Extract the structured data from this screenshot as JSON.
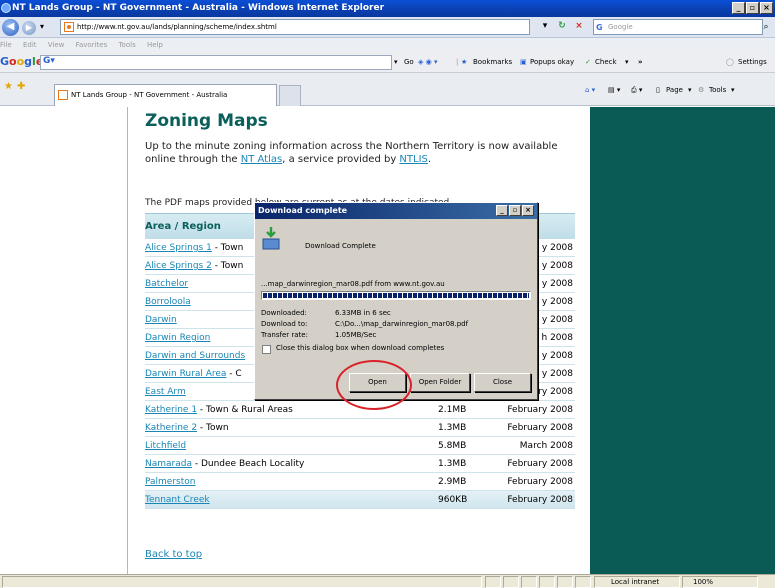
{
  "window": {
    "title": "NT Lands Group - NT Government - Australia - Windows Internet Explorer"
  },
  "address": {
    "url": "http://www.nt.gov.au/lands/planning/scheme/index.shtml"
  },
  "search": {
    "placeholder": "Google"
  },
  "menu": [
    "File",
    "Edit",
    "View",
    "Favorites",
    "Tools",
    "Help"
  ],
  "google_toolbar": {
    "logo": "Google",
    "go_label": "Go",
    "bookmarks": "Bookmarks",
    "popups": "Popups okay",
    "check": "Check",
    "more": "»",
    "settings": "Settings"
  },
  "tab": {
    "title": "NT Lands Group - NT Government - Australia"
  },
  "command_bar": {
    "page": "Page",
    "tools": "Tools"
  },
  "page": {
    "heading": "Zoning Maps",
    "intro_before": "Up to the minute zoning information across the Northern Territory is now available online through the ",
    "intro_link1": "NT Atlas",
    "intro_mid": ", a service provided by ",
    "intro_link2": "NTLIS",
    "intro_end": ".",
    "pdf_text": "The PDF maps provided below are current as at the dates indicated.",
    "table_header": "Area / Region",
    "back_to_top": "Back to top",
    "rows": [
      {
        "name": "Alice Springs 1",
        "desc": " - Town",
        "size": "",
        "date": "y 2008"
      },
      {
        "name": "Alice Springs 2",
        "desc": " - Town",
        "size": "",
        "date": "y 2008"
      },
      {
        "name": "Batchelor",
        "desc": "",
        "size": "",
        "date": "y 2008"
      },
      {
        "name": "Borroloola",
        "desc": "",
        "size": "",
        "date": "y 2008"
      },
      {
        "name": "Darwin",
        "desc": "",
        "size": "",
        "date": "y 2008"
      },
      {
        "name": "Darwin Region",
        "desc": "",
        "size": "",
        "date": "h 2008"
      },
      {
        "name": "Darwin and Surrounds",
        "desc": "",
        "size": "",
        "date": "y 2008"
      },
      {
        "name": "Darwin Rural Area",
        "desc": " - C",
        "size": "",
        "date": "y 2008"
      },
      {
        "name": "East Arm",
        "desc": "",
        "size": "1.8MB",
        "date": "February 2008"
      },
      {
        "name": "Katherine 1",
        "desc": " - Town & Rural Areas",
        "size": "2.1MB",
        "date": "February 2008"
      },
      {
        "name": "Katherine 2",
        "desc": " - Town",
        "size": "1.3MB",
        "date": "February 2008"
      },
      {
        "name": "Litchfield",
        "desc": "",
        "size": "5.8MB",
        "date": "March 2008"
      },
      {
        "name": "Namarada",
        "desc": " - Dundee Beach Locality",
        "size": "1.3MB",
        "date": "February 2008"
      },
      {
        "name": "Palmerston",
        "desc": "",
        "size": "2.9MB",
        "date": "February 2008"
      },
      {
        "name": "Tennant Creek",
        "desc": "",
        "size": "960KB",
        "date": "February 2008"
      }
    ]
  },
  "dialog": {
    "title": "Download complete",
    "status": "Download Complete",
    "file": "...map_darwinregion_mar08.pdf from www.nt.gov.au",
    "progress_fraction": 1.0,
    "downloaded_label": "Downloaded:",
    "downloaded_value": "6.33MB in 6 sec",
    "download_to_label": "Download to:",
    "download_to_value": "C:\\Do...\\map_darwinregion_mar08.pdf",
    "rate_label": "Transfer rate:",
    "rate_value": "1.05MB/Sec",
    "checkbox_label": "Close this dialog box when download completes",
    "open": "Open",
    "open_folder": "Open Folder",
    "close": "Close"
  },
  "statusbar": {
    "zone": "Local intranet",
    "zoom": "100%"
  },
  "colors": {
    "title_bar": "#0a3fb0",
    "heading": "#0a5f5a",
    "link": "#1a86b5",
    "sidebar": "#0a5a55",
    "annotation": "#d8232a"
  }
}
